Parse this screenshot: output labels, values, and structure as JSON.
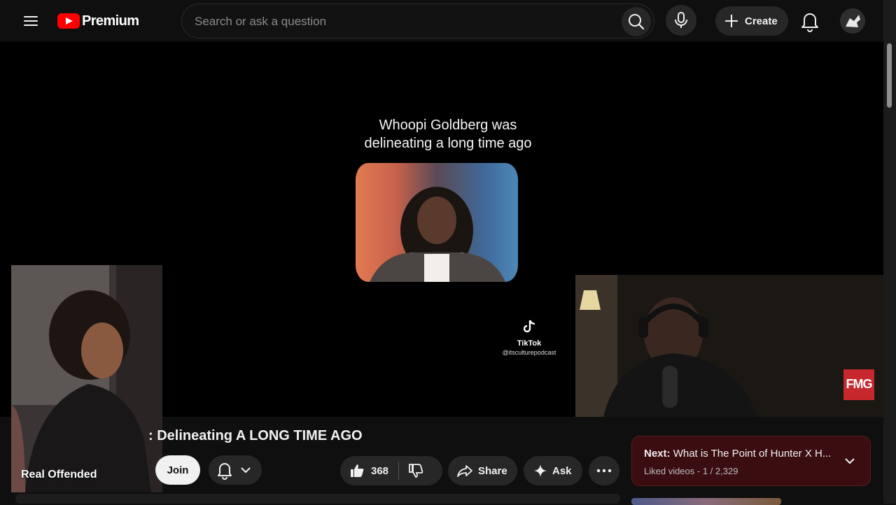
{
  "header": {
    "logo_text": "Premium",
    "search_placeholder": "Search or ask a question",
    "create_label": "Create"
  },
  "player": {
    "caption_line1": "Whoopi Goldberg was",
    "caption_line2": "delineating a long time ago",
    "tiktok_label": "TikTok",
    "tiktok_handle": "@itsculturepodcast",
    "cam_label": "Real Offended",
    "watermark": "FMG"
  },
  "video": {
    "title": ": Delineating A LONG TIME AGO",
    "join_label": "Join",
    "like_count": "368",
    "share_label": "Share",
    "ask_label": "Ask"
  },
  "next_up": {
    "prefix": "Next:",
    "title": "What is The Point of Hunter X H...",
    "subtitle": "Liked videos - 1 / 2,329"
  },
  "colors": {
    "background": "#0f0f0f",
    "brand_red": "#ff0000",
    "next_box": "#3a0d10"
  }
}
